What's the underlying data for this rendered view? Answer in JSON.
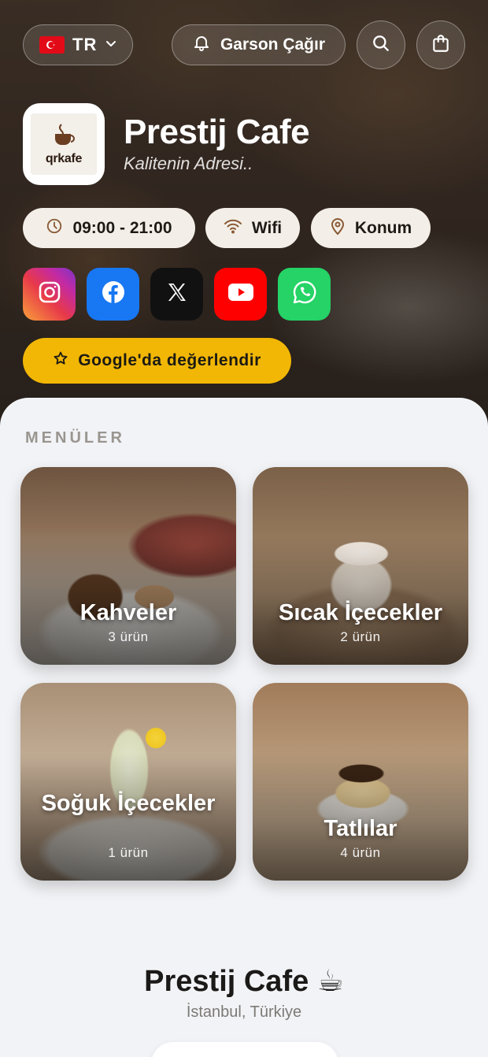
{
  "header": {
    "language": "TR",
    "waiter_button": "Garson Çağır"
  },
  "cafe": {
    "name": "Prestij Cafe",
    "slogan": "Kalitenin Adresi..",
    "logo_text": "qrkafe"
  },
  "info": {
    "hours": "09:00 - 21:00",
    "wifi": "Wifi",
    "location": "Konum"
  },
  "social": [
    "instagram-icon",
    "facebook-icon",
    "x-icon",
    "youtube-icon",
    "whatsapp-icon"
  ],
  "rate_button": "Google'da değerlendir",
  "menus": {
    "title": "MENÜLER",
    "items": [
      {
        "title": "Kahveler",
        "count": "3 ürün"
      },
      {
        "title": "Sıcak İçecekler",
        "count": "2 ürün"
      },
      {
        "title": "Soğuk İçecekler",
        "count": "1 ürün"
      },
      {
        "title": "Tatlılar",
        "count": "4 ürün"
      }
    ]
  },
  "footer": {
    "name": "Prestij Cafe ☕",
    "location": "İstanbul, Türkiye"
  },
  "colors": {
    "accent_yellow": "#f2b705",
    "instagram": "#d6287a",
    "facebook": "#1877f2",
    "x": "#111111",
    "youtube": "#ff0000",
    "whatsapp": "#25d366"
  }
}
